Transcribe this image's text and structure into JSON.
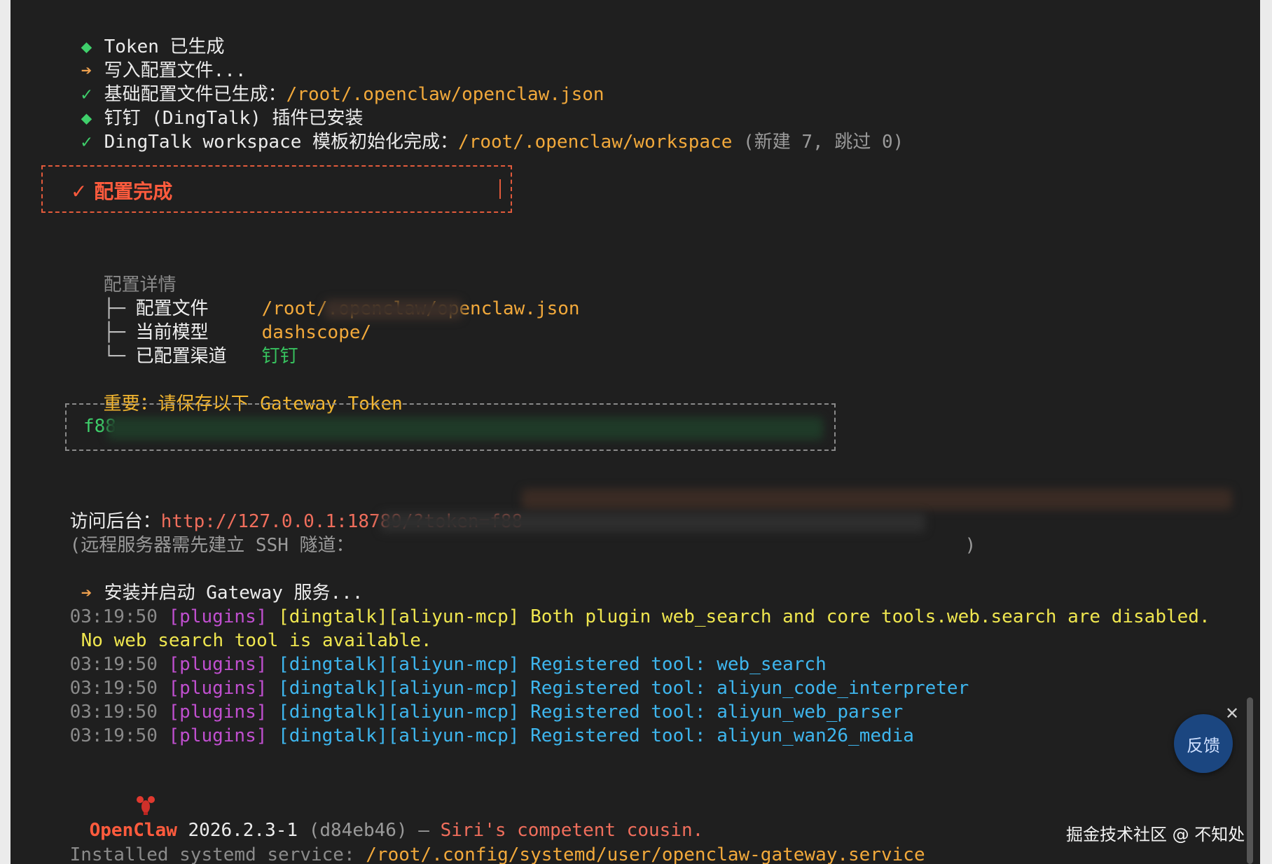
{
  "colors": {
    "terminal_bg": "#1f1f1f",
    "green": "#3fcf6b",
    "orange": "#f0a24f",
    "red": "#ff5b3d",
    "magenta": "#c04fcf",
    "yellow": "#efe64f",
    "cyan": "#3eb6ee",
    "feedback_bg": "#1b4680"
  },
  "setup": {
    "token_generated": "Token 已生成",
    "writing_config": "写入配置文件...",
    "base_config_label": "基础配置文件已生成：",
    "base_config_path": "/root/.openclaw/openclaw.json",
    "plugin_installed": "钉钉 (DingTalk) 插件已安装",
    "workspace_label": "DingTalk workspace 模板初始化完成：",
    "workspace_path": "/root/.openclaw/workspace",
    "workspace_note": "(新建 7, 跳过 0)"
  },
  "done_box": {
    "text": "✓ 配置完成"
  },
  "details": {
    "title": "配置详情",
    "rows": [
      {
        "glyph": "├─",
        "key": "配置文件",
        "value": "/root/.openclaw/openclaw.json"
      },
      {
        "glyph": "├─",
        "key": "当前模型",
        "value": "dashscope/"
      },
      {
        "glyph": "└─",
        "key": "已配置渠道",
        "value": "钉钉"
      }
    ]
  },
  "token_section": {
    "important": "重要：请保存以下 Gateway Token",
    "token_prefix": "f88"
  },
  "access": {
    "label": "访问后台：",
    "url": "http://127.0.0.1:18789/?token=f88",
    "ssh_note_open": "(远程服务器需先建立 SSH 隧道：",
    "ssh_note_close": ")"
  },
  "gateway": {
    "install_label": "安装并启动 Gateway 服务...",
    "logs": [
      {
        "time": "03:19:50",
        "tag": "[plugins]",
        "scope": "[dingtalk][aliyun-mcp]",
        "msg": "Both plugin web_search and core tools.web.search are disabled.",
        "kind": "warn"
      },
      {
        "time": "03:19:50",
        "tag": "[plugins]",
        "scope": "[dingtalk][aliyun-mcp]",
        "msg": "Registered tool: web_search",
        "kind": "info"
      },
      {
        "time": "03:19:50",
        "tag": "[plugins]",
        "scope": "[dingtalk][aliyun-mcp]",
        "msg": "Registered tool: aliyun_code_interpreter",
        "kind": "info"
      },
      {
        "time": "03:19:50",
        "tag": "[plugins]",
        "scope": "[dingtalk][aliyun-mcp]",
        "msg": "Registered tool: aliyun_web_parser",
        "kind": "info"
      },
      {
        "time": "03:19:50",
        "tag": "[plugins]",
        "scope": "[dingtalk][aliyun-mcp]",
        "msg": "Registered tool: aliyun_wan26_media",
        "kind": "info"
      }
    ],
    "warn_continuation": "No web search tool is available."
  },
  "banner": {
    "name": "OpenClaw",
    "version": "2026.2.3-1",
    "hash": "(d84eb46)",
    "dash": "—",
    "tagline": "Siri's competent cousin."
  },
  "systemd": {
    "label": "Installed systemd service:",
    "path": "/root/.config/systemd/user/openclaw-gateway.service"
  },
  "feedback": {
    "label": "反馈",
    "close": "✕"
  },
  "watermark": "掘金技术社区 @ 不知处",
  "icons": [
    "diamond-icon",
    "arrow-right-icon",
    "check-icon",
    "lobster-icon",
    "close-icon"
  ]
}
